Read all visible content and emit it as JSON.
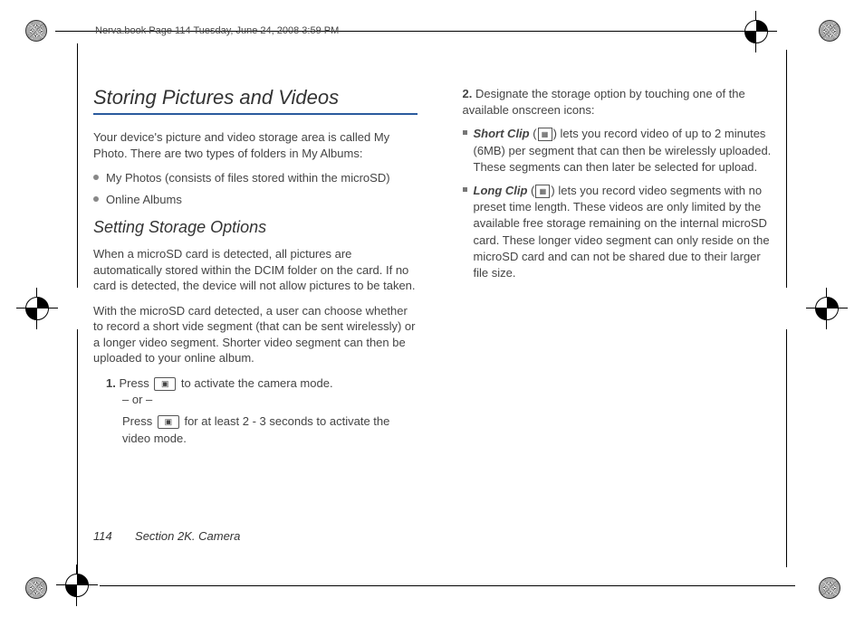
{
  "header": {
    "meta_text": "Nerva.book  Page 114  Tuesday, June 24, 2008  3:59 PM"
  },
  "col1": {
    "title": "Storing Pictures and Videos",
    "intro": "Your device's picture and video storage area is called My Photo. There are two types of folders in My Albums:",
    "bullets": [
      "My Photos (consists of files stored within the microSD)",
      "Online Albums"
    ],
    "subhead": "Setting Storage Options",
    "p1": "When a microSD card is detected, all pictures are automatically stored within the DCIM folder on the card. If no card is detected, the device will not allow pictures to be taken.",
    "p2": "With the microSD card detected, a user can choose whether to record a short vide segment (that can be sent wirelessly) or a longer video segment. Shorter video segment can then be uploaded to your online album.",
    "step1_pre": "Press ",
    "step1_post": " to activate the camera mode.",
    "or": "– or –",
    "step1b_pre": "Press ",
    "step1b_post": " for at least 2 - 3 seconds to activate the video mode."
  },
  "col2": {
    "step2": "Designate the storage option by touching one of the available onscreen icons:",
    "short_label": "Short Clip",
    "short_text": " lets you record video of up to 2 minutes (6MB) per segment that can then be wirelessly uploaded. These segments can then later be selected for upload.",
    "long_label": "Long Clip",
    "long_text": " lets you record video segments with no preset time length. These videos are only limited by the available free storage remaining on the internal microSD card. These longer video segment can only reside on the microSD card and can not be shared due to their larger file size."
  },
  "footer": {
    "page_num": "114",
    "section": "Section 2K. Camera"
  }
}
